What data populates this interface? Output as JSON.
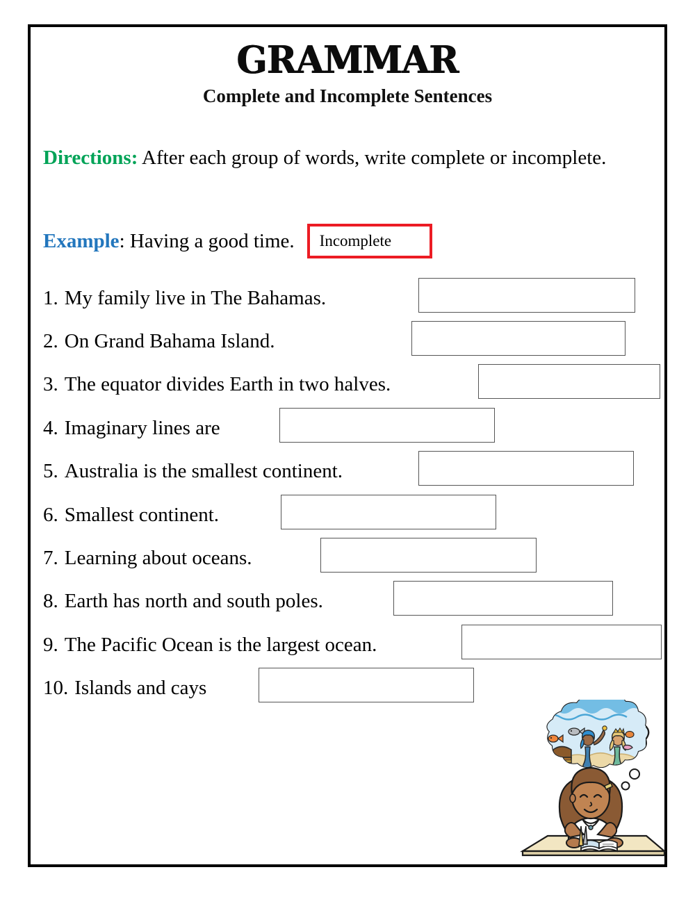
{
  "page": {
    "title": "GRAMMAR",
    "subtitle": "Complete and Incomplete Sentences"
  },
  "directions": {
    "label": "Directions:",
    "text": " After each group of words, write complete or incomplete.",
    "label_color": "#00a357"
  },
  "example": {
    "label": "Example",
    "text": ": Having a good time.",
    "answer": "Incomplete",
    "label_color": "#2276bd",
    "box_border_color": "#ec1c24"
  },
  "questions": [
    {
      "number": "1.",
      "text": "My family live in The Bahamas.",
      "answer": ""
    },
    {
      "number": "2.",
      "text": "On Grand Bahama Island.",
      "answer": ""
    },
    {
      "number": "3.",
      "text": "The equator divides Earth in two halves.",
      "answer": ""
    },
    {
      "number": "4.",
      "text": "Imaginary lines are",
      "answer": ""
    },
    {
      "number": "5.",
      "text": "Australia is the smallest continent.",
      "answer": ""
    },
    {
      "number": "6.",
      "text": "Smallest continent.",
      "answer": ""
    },
    {
      "number": "7.",
      "text": "Learning about oceans.",
      "answer": ""
    },
    {
      "number": "8.",
      "text": "Earth has north and south poles.",
      "answer": ""
    },
    {
      "number": "9.",
      "text": "The Pacific Ocean is the largest ocean.",
      "answer": ""
    },
    {
      "number": "10.",
      "text": "Islands and cays",
      "answer": ""
    }
  ],
  "illustration": {
    "name": "girl-daydreaming-about-mermaids",
    "description": "A girl writing at a desk with a thought bubble showing an underwater scene with two mermaids, a treasure chest and a fish."
  }
}
